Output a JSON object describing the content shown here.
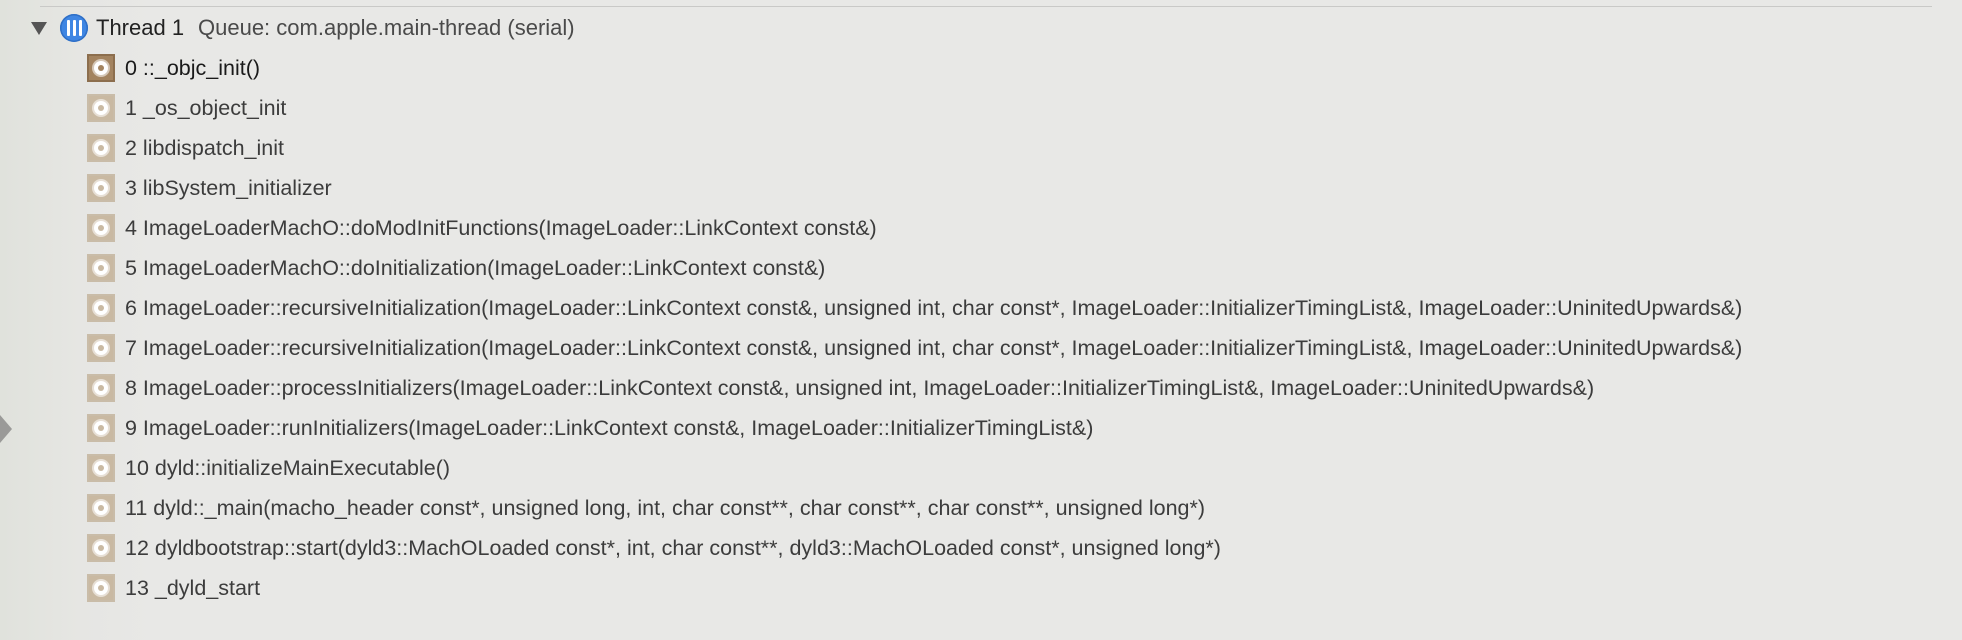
{
  "thread": {
    "title": "Thread 1",
    "queue": "Queue: com.apple.main-thread (serial)",
    "icon": "thread-icon",
    "accent_color": "#3f86e3"
  },
  "frames": [
    {
      "label": "0 ::_objc_init()",
      "active": true
    },
    {
      "label": "1 _os_object_init"
    },
    {
      "label": "2 libdispatch_init"
    },
    {
      "label": "3 libSystem_initializer"
    },
    {
      "label": "4 ImageLoaderMachO::doModInitFunctions(ImageLoader::LinkContext const&)"
    },
    {
      "label": "5 ImageLoaderMachO::doInitialization(ImageLoader::LinkContext const&)"
    },
    {
      "label": "6 ImageLoader::recursiveInitialization(ImageLoader::LinkContext const&, unsigned int, char const*, ImageLoader::InitializerTimingList&, ImageLoader::UninitedUpwards&)"
    },
    {
      "label": "7 ImageLoader::recursiveInitialization(ImageLoader::LinkContext const&, unsigned int, char const*, ImageLoader::InitializerTimingList&, ImageLoader::UninitedUpwards&)"
    },
    {
      "label": "8 ImageLoader::processInitializers(ImageLoader::LinkContext const&, unsigned int, ImageLoader::InitializerTimingList&, ImageLoader::UninitedUpwards&)"
    },
    {
      "label": "9 ImageLoader::runInitializers(ImageLoader::LinkContext const&, ImageLoader::InitializerTimingList&)"
    },
    {
      "label": "10 dyld::initializeMainExecutable()"
    },
    {
      "label": "11 dyld::_main(macho_header const*, unsigned long, int, char const**, char const**, char const**, unsigned long*)"
    },
    {
      "label": "12 dyldbootstrap::start(dyld3::MachOLoaded const*, int, char const**, dyld3::MachOLoaded const*, unsigned long*)"
    },
    {
      "label": "13 _dyld_start"
    }
  ],
  "icons": {
    "disclosure": "disclosure-triangle-down-icon",
    "frame": "gear-icon",
    "marker": "instruction-pointer-marker-icon"
  },
  "colors": {
    "frame_icon_active": "#a3835f",
    "frame_icon_inactive": "#c9b9a2"
  }
}
